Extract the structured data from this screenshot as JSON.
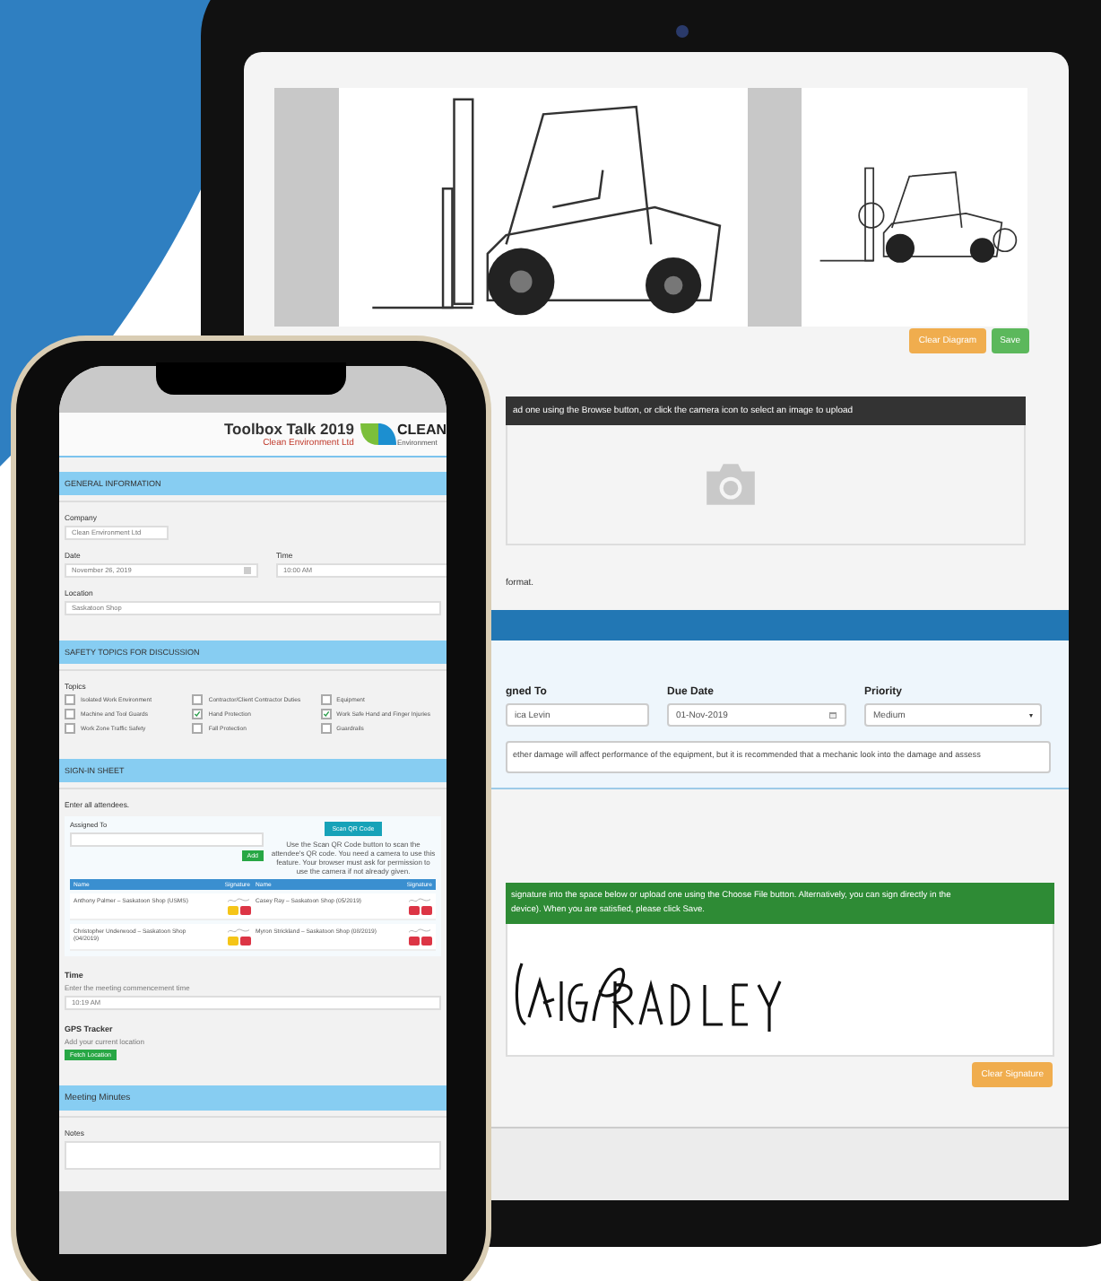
{
  "tablet": {
    "diagram_buttons": [
      {
        "label": "Clear Diagram",
        "kind": "warning"
      },
      {
        "label": "Save",
        "kind": "success"
      }
    ],
    "photo_instructions": "ad one using the Browse button, or click the camera icon to select an image to upload",
    "format_note": "format.",
    "task_fields": [
      {
        "label": "gned To",
        "value": "ica Levin",
        "kind": "text"
      },
      {
        "label": "Due Date",
        "value": "01-Nov-2019",
        "kind": "date"
      },
      {
        "label": "Priority",
        "value": "Medium",
        "kind": "select"
      }
    ],
    "description": "ether damage will affect performance of the equipment, but it is recommended that a mechanic look into the damage and assess",
    "signature_instructions": [
      "signature into the space below or upload one using the Choose File button. Alternatively, you can sign directly in the",
      "device). When you are satisfied, please click Save."
    ],
    "signature_button": {
      "label": "Clear Signature",
      "kind": "warning"
    }
  },
  "phone": {
    "title": "Toolbox Talk 2019",
    "subtitle": "Clean Environment Ltd",
    "logo": {
      "word": "CLEAN",
      "tagline": "Environment"
    },
    "general": {
      "heading": "GENERAL INFORMATION",
      "company": {
        "label": "Company",
        "value": "Clean Environment Ltd"
      },
      "date": {
        "label": "Date",
        "value": "November 26, 2019"
      },
      "time": {
        "label": "Time",
        "value": "10:00 AM"
      },
      "location": {
        "label": "Location",
        "value": "Saskatoon Shop"
      }
    },
    "topics": {
      "heading": "SAFETY TOPICS FOR DISCUSSION",
      "label": "Topics",
      "items": [
        {
          "label": "Isolated Work Environment",
          "checked": false
        },
        {
          "label": "Contractor/Client Contractor Duties",
          "checked": false
        },
        {
          "label": "Equipment",
          "checked": false
        },
        {
          "label": "Machine and Tool Guards",
          "checked": false
        },
        {
          "label": "Hand Protection",
          "checked": true
        },
        {
          "label": "Work Safe Hand and Finger Injuries",
          "checked": true
        },
        {
          "label": "Work Zone Traffic Safety",
          "checked": false
        },
        {
          "label": "Fall Protection",
          "checked": false
        },
        {
          "label": "Guardrails",
          "checked": false
        }
      ]
    },
    "signin": {
      "heading": "SIGN-IN SHEET",
      "intro": "Enter all attendees.",
      "assigned_label": "Assigned To",
      "add_button": "Add",
      "scan_button": "Scan QR Code",
      "scan_help": "Use the Scan QR Code button to scan the attendee's QR code. You need a camera to use this feature. Your browser must ask for permission to use the camera if not already given.",
      "columns": [
        "Name",
        "Signature",
        "Name",
        "Signature"
      ],
      "attendees": [
        {
          "name": "Anthony Palmer – Saskatoon Shop (USMS)",
          "signed": true
        },
        {
          "name": "Casey Ray – Saskatoon Shop (05/2019)",
          "signed": true
        },
        {
          "name": "Christopher Underwood – Saskatoon Shop (04/2019)",
          "signed": true
        },
        {
          "name": "Myron Strickland – Saskatoon Shop (08/2019)",
          "signed": true
        }
      ],
      "time": {
        "label": "Time",
        "hint": "Enter the meeting commencement time",
        "value": "10:19 AM"
      },
      "gps": {
        "label": "GPS Tracker",
        "hint": "Add your current location",
        "button": "Fetch Location"
      }
    },
    "minutes": {
      "heading": "Meeting Minutes",
      "notes_label": "Notes"
    }
  }
}
